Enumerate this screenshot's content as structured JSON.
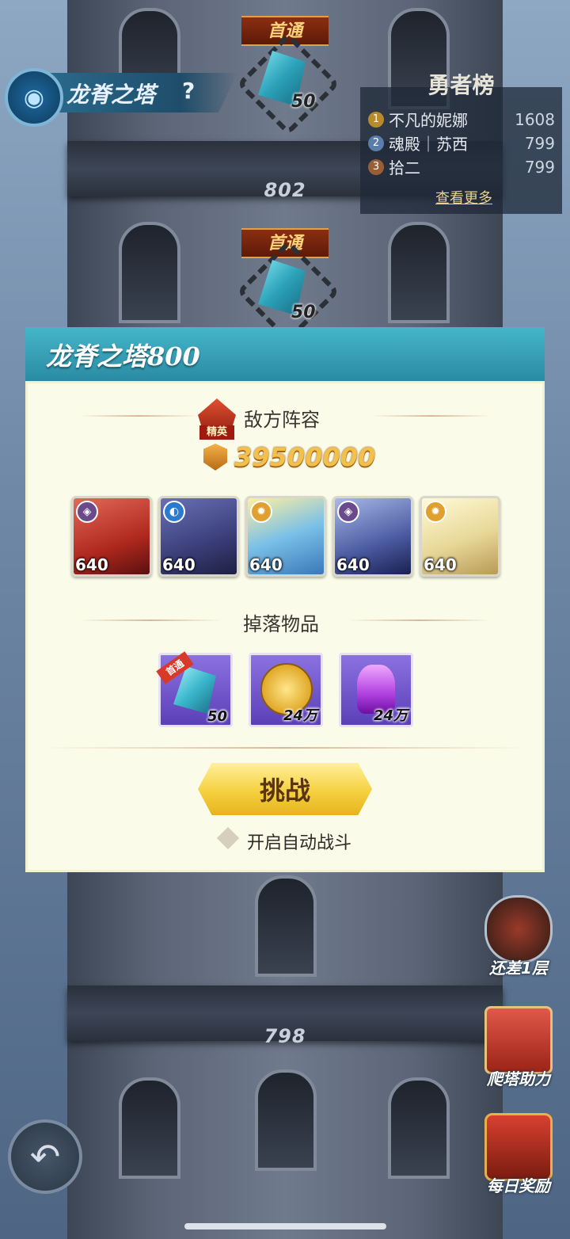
{
  "tower": {
    "title": "龙脊之塔",
    "help": "?",
    "floors": [
      {
        "number": "802"
      },
      {
        "number": "798"
      }
    ],
    "first_clear_tags": [
      "首通",
      "首通"
    ],
    "drop_counts": [
      "50",
      "50"
    ]
  },
  "leaderboard": {
    "title": "勇者榜",
    "rows": [
      {
        "rank": "1",
        "name": "不凡的妮娜",
        "score": "1608"
      },
      {
        "rank": "2",
        "name": "魂殿｜苏西",
        "score": "799"
      },
      {
        "rank": "3",
        "name": "拾二",
        "score": "799"
      }
    ],
    "more": "查看更多"
  },
  "side": {
    "remaining_label": "还差1层",
    "assist_label": "爬塔助力",
    "daily_label": "每日奖励"
  },
  "dialog": {
    "title": "龙脊之塔800",
    "enemy_title": "敌方阵容",
    "elite_label": "精英",
    "power": "39500000",
    "heroes": [
      {
        "level": "640",
        "faction": "demon"
      },
      {
        "level": "640",
        "faction": "water"
      },
      {
        "level": "640",
        "faction": "light"
      },
      {
        "level": "640",
        "faction": "demon"
      },
      {
        "level": "640",
        "faction": "light"
      }
    ],
    "drops_title": "掉落物品",
    "drops": [
      {
        "name": "crystal",
        "count": "50",
        "first_clear": "首通"
      },
      {
        "name": "gold-coin",
        "count": "24万"
      },
      {
        "name": "exp-potion",
        "count": "24万"
      }
    ],
    "challenge_button": "挑战",
    "auto_battle": "开启自动战斗"
  },
  "colors": {
    "dialog_header": "#2a8ba3",
    "dialog_body": "#fafbe8",
    "button_gold": "#f5d040",
    "power_gold": "#f3c14b"
  }
}
